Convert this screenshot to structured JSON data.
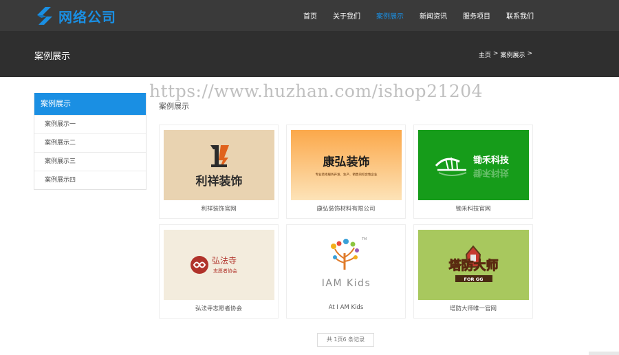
{
  "header": {
    "logo_text": "网络公司",
    "nav": [
      "首页",
      "关于我们",
      "案例展示",
      "新闻资讯",
      "服务项目",
      "联系我们"
    ],
    "active_index": 2
  },
  "banner": {
    "title": "案例展示",
    "breadcrumb": [
      "主页",
      ">",
      "案例展示",
      ">"
    ]
  },
  "watermark": "https://www.huzhan.com/ishop21204",
  "sidebar": {
    "title": "案例展示",
    "items": [
      "案例展示一",
      "案例展示二",
      "案例展示三",
      "案例展示四"
    ]
  },
  "section_label": "案例展示",
  "cases": [
    {
      "caption": "利祥装饰官网",
      "logo_text": "利祥装饰",
      "bg": "#e9d3b1"
    },
    {
      "caption": "康弘装饰材料有限公司",
      "logo_text": "康弘装饰",
      "logo_sub": "专业装修服务开发、生产、销售的综合性企业",
      "bg": "#fbb55a"
    },
    {
      "caption": "锄禾科技官网",
      "logo_text": "锄禾科技",
      "bg": "#169c1a"
    },
    {
      "caption": "弘法寺志愿者协会",
      "logo_text": "弘法寺",
      "logo_sub": "志愿者协会",
      "bg": "#f3ecdd"
    },
    {
      "caption": "At I AM Kids",
      "logo_text": "IAM Kids",
      "bg": "#ffffff"
    },
    {
      "caption": "塔防大师唯一官网",
      "logo_text": "塔防大师",
      "logo_sub": "FOR GG",
      "bg": "#a8c85e"
    }
  ],
  "pager": "共 1页6 条记录",
  "colors": {
    "accent": "#1a8fe3",
    "topbar": "#3a3a3a",
    "banner": "#2f2f2f"
  }
}
